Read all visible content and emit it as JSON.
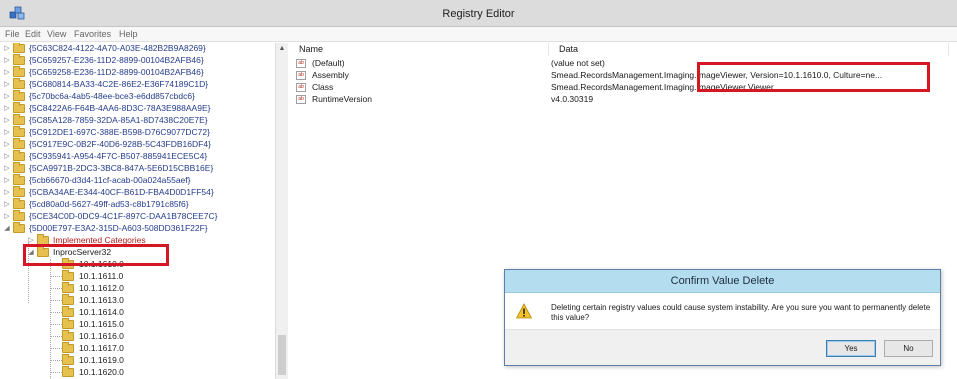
{
  "window": {
    "title": "Registry Editor",
    "app_icon": "regedit-icon"
  },
  "menu": {
    "items": [
      "File",
      "Edit",
      "View",
      "Favorites",
      "Help"
    ]
  },
  "tree": {
    "keys": [
      "{5C63C824-4122-4A70-A03E-482B2B9A8269}",
      "{5C659257-E236-11D2-8899-00104B2AFB46}",
      "{5C659258-E236-11D2-8899-00104B2AFB46}",
      "{5C680814-BA33-4C2E-86E2-E36F74189C1D}",
      "{5c70bc6a-4ab5-48ee-bce3-e6dd857cbdc6}",
      "{5C8422A6-F64B-4AA6-8D3C-78A3E988AA9E}",
      "{5C85A128-7859-32DA-85A1-8D7438C20E7E}",
      "{5C912DE1-697C-388E-B598-D76C9077DC72}",
      "{5C917E9C-0B2F-40D6-928B-5C43FDB16DF4}",
      "{5C935941-A954-4F7C-B507-885941ECE5C4}",
      "{5CA9971B-2DC3-3BC8-847A-5E6D15CBB16E}",
      "{5cb66670-d3d4-11cf-acab-00a024a55aef}",
      "{5CBA34AE-E344-40CF-B61D-FBA4D0D1FF54}",
      "{5cd80a0d-5627-49ff-ad53-c8b1791c85f6}",
      "{5CE34C0D-0DC9-4C1F-897C-DAA1B78CEE7C}",
      "{5D00E797-E3A2-315D-A603-508DD361F22F}"
    ],
    "children": [
      "Implemented Categories",
      "InprocServer32"
    ],
    "versions": [
      "10.1.1610.0",
      "10.1.1611.0",
      "10.1.1612.0",
      "10.1.1613.0",
      "10.1.1614.0",
      "10.1.1615.0",
      "10.1.1616.0",
      "10.1.1617.0",
      "10.1.1619.0",
      "10.1.1620.0"
    ]
  },
  "list": {
    "columns": {
      "name": "Name",
      "data": "Data"
    },
    "rows": [
      {
        "name": "(Default)",
        "data": "(value not set)"
      },
      {
        "name": "Assembly",
        "data": "Smead.RecordsManagement.Imaging.ImageViewer, Version=10.1.1610.0, Culture=ne..."
      },
      {
        "name": "Class",
        "data": "Smead.RecordsManagement.Imaging.ImageViewer.Viewer"
      },
      {
        "name": "RuntimeVersion",
        "data": "v4.0.30319"
      }
    ],
    "value_icon_label": "ab"
  },
  "dialog": {
    "title": "Confirm Value Delete",
    "message": "Deleting certain registry values could cause system instability. Are you sure you want to permanently delete this value?",
    "yes_label": "Yes",
    "no_label": "No"
  },
  "colors": {
    "highlight": "#d51623",
    "dialog_title_bg": "#b4ddf0",
    "folder": "#e7c14f"
  }
}
